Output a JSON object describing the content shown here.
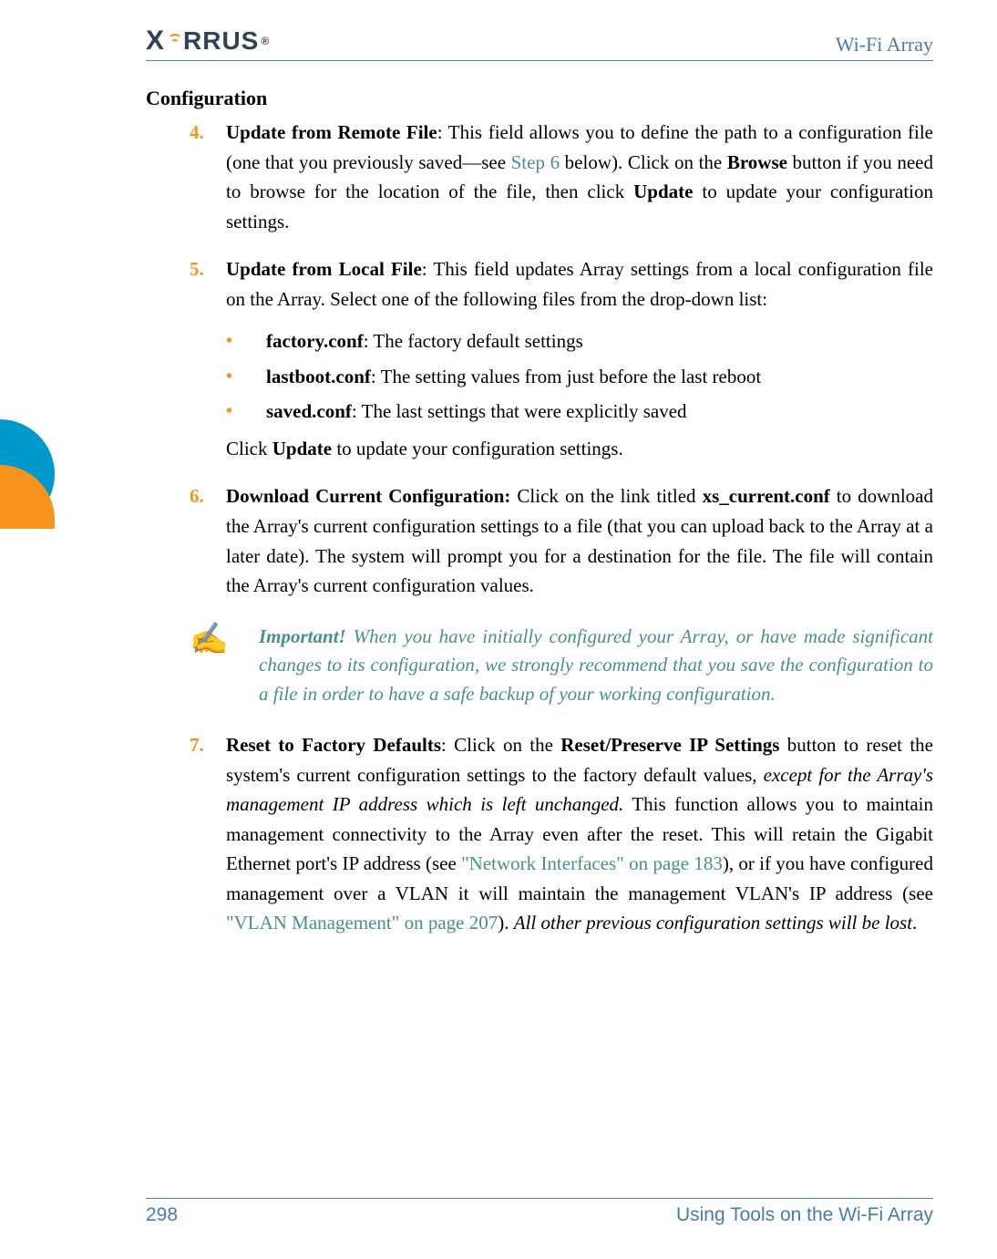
{
  "header": {
    "logo_text": "XIRRUS",
    "title": "Wi-Fi Array"
  },
  "section_title": "Configuration",
  "steps": {
    "s4": {
      "num": "4.",
      "lead_bold": "Update from Remote File",
      "colon": ": This field allows you to define the path to a configuration file (one that you previously saved—see ",
      "link1": "Step 6",
      "after1": " below). Click on the ",
      "bold2": "Browse",
      "after2": " button if you need to browse for the location of the file, then click ",
      "bold3": "Update",
      "after3": " to update your configuration settings."
    },
    "s5": {
      "num": "5.",
      "lead_bold": "Update from Local File",
      "rest": ": This field updates Array settings from a local configuration file on the Array. Select one of the following files from the drop-down list:",
      "bullets": [
        {
          "bold": "factory.conf",
          "rest": ": The factory default settings"
        },
        {
          "bold": "lastboot.conf",
          "rest": ": The setting values from just before the last reboot"
        },
        {
          "bold": "saved.conf",
          "rest": ": The last settings that were explicitly saved"
        }
      ],
      "after_pre": "Click ",
      "after_bold": "Update",
      "after_post": " to update your configuration settings."
    },
    "s6": {
      "num": "6.",
      "lead_bold": "Download Current Configuration:",
      "pre2": " Click on the link titled ",
      "bold2": "xs_current.conf",
      "rest": " to download the Array's current configuration settings to a file (that you can upload back to the Array at a later date). The system will prompt you for a destination for the file. The file will contain the Array's current configuration values."
    },
    "s7": {
      "num": "7.",
      "lead_bold": "Reset to Factory Defaults",
      "pre2": ": Click on the ",
      "bold2": "Reset/Preserve IP Settings",
      "post2": " button to reset the system's current configuration settings to the factory default values, ",
      "italic1": "except for the Array's management IP address which is left unchanged.",
      "mid": " This function allows you to maintain management connectivity to the Array even after the reset. This will retain the Gigabit Ethernet port's IP address (see ",
      "link1": "\"Network Interfaces\" on page 183",
      "mid2": "), or if you have configured management over a VLAN it will maintain the management VLAN's IP address (see ",
      "link2": "\"VLAN Management\" on page 207",
      "mid3": "). ",
      "italic2": "All other previous configuration settings will be lost",
      "end": "."
    }
  },
  "note": {
    "important": "Important!",
    "text": " When you have initially configured your Array, or have made significant changes to its configuration, we strongly recommend that you save the configuration to a file in order to have a safe backup of your working configuration."
  },
  "footer": {
    "page_number": "298",
    "title": "Using Tools on the Wi-Fi Array"
  }
}
